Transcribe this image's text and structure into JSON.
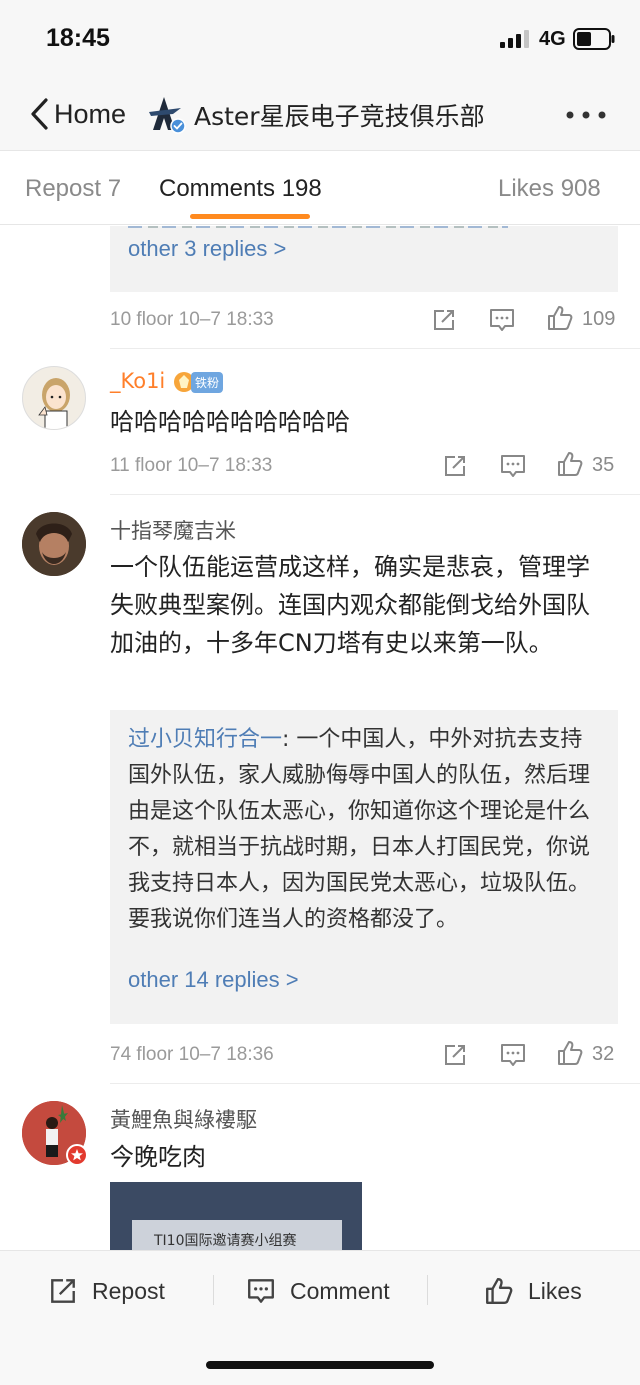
{
  "status_bar": {
    "time": "18:45",
    "network": "4G"
  },
  "nav": {
    "back_label": "Home",
    "title": "Aster星辰电子竞技俱乐部"
  },
  "tabs": {
    "repost": "Repost 7",
    "comments": "Comments 198",
    "likes": "Likes 908"
  },
  "comments": [
    {
      "replies_more": "other 3 replies >",
      "meta": "10 floor 10–7 18:33",
      "likes": "109"
    },
    {
      "username": "_Ko1i",
      "fan_badge": "铁粉",
      "text": "哈哈哈哈哈哈哈哈哈哈",
      "meta": "11 floor 10–7 18:33",
      "likes": "35"
    },
    {
      "username": "十指琴魔吉米",
      "text": "一个队伍能运营成这样，确实是悲哀，管理学失败典型案例。连国内观众都能倒戈给外国队加油的，十多年CN刀塔有史以来第一队。",
      "reply_author": "过小贝知行合一",
      "reply_text": ": 一个中国人，中外对抗去支持国外队伍，家人威胁侮辱中国人的队伍，然后理由是这个队伍太恶心，你知道你这个理论是什么不，就相当于抗战时期，日本人打国民党，你说我支持日本人，因为国民党太恶心，垃圾队伍。要我说你们连当人的资格都没了。",
      "replies_more": "other 14 replies >",
      "meta": "74 floor 10–7 18:36",
      "likes": "32"
    },
    {
      "username": "黃鯉魚與綠褸駆",
      "text": "今晚吃肉",
      "image_caption": "TI10国际邀请赛小组赛"
    }
  ],
  "bottom_bar": {
    "repost": "Repost",
    "comment": "Comment",
    "likes": "Likes"
  },
  "colors": {
    "accent": "#ff8a1f",
    "link": "#4f7db5",
    "meta": "#9a9a9a"
  }
}
